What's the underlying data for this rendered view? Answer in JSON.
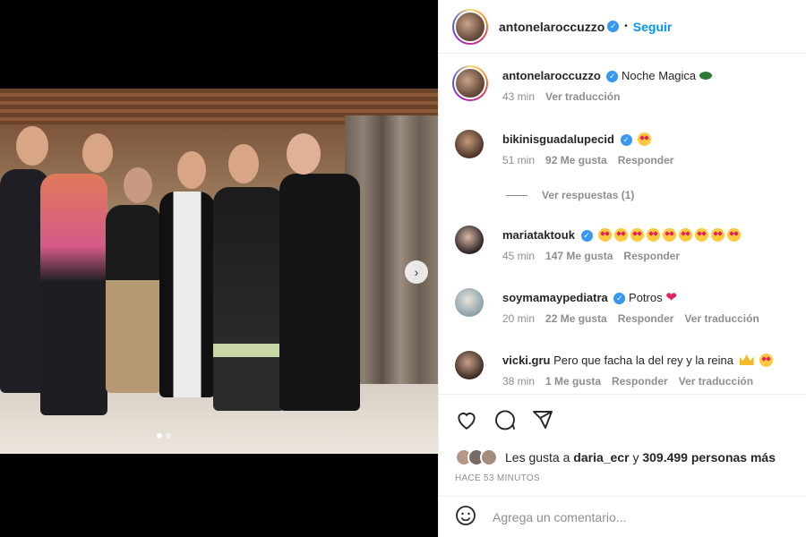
{
  "post": {
    "author": "antonelaroccuzzo",
    "follow_label": "Seguir",
    "separator": "•"
  },
  "caption": {
    "username": "antonelaroccuzzo",
    "text": "Noche Magica",
    "time": "43 min",
    "translate": "Ver traducción"
  },
  "comments": [
    {
      "username": "bikinisguadalupecid",
      "verified": true,
      "text": "",
      "emoji": "star-eyes x1",
      "time": "51 min",
      "likes": "92 Me gusta",
      "reply": "Responder",
      "translate": ""
    },
    {
      "username": "mariataktouk",
      "verified": true,
      "text": "",
      "emoji": "star-eyes x9",
      "time": "45 min",
      "likes": "147 Me gusta",
      "reply": "Responder",
      "translate": ""
    },
    {
      "username": "soymamaypediatra",
      "verified": false,
      "text": "Potros",
      "emoji": "heart",
      "time": "20 min",
      "likes": "22 Me gusta",
      "reply": "Responder",
      "translate": "Ver traducción"
    },
    {
      "username": "vicki.gru",
      "verified": false,
      "text": "Pero que facha la del rey y la reina",
      "emoji": "crown + star-eyes",
      "time": "38 min",
      "likes": "1 Me gusta",
      "reply": "Responder",
      "translate": "Ver traducción"
    }
  ],
  "view_replies": "Ver respuestas (1)",
  "likes": {
    "prefix": "Les gusta a",
    "user": "daria_ecr",
    "connector": "y",
    "others": "309.499 personas más"
  },
  "timestamp": "HACE 53 MINUTOS",
  "add_comment_placeholder": "Agrega un comentario...",
  "icons": [
    "heart-icon",
    "comment-icon",
    "share-icon",
    "emoji-icon",
    "verified-icon",
    "next-arrow-icon"
  ],
  "colors": {
    "accent": "#0095f6",
    "verified": "#3897f0",
    "muted": "#8e8e8e"
  }
}
